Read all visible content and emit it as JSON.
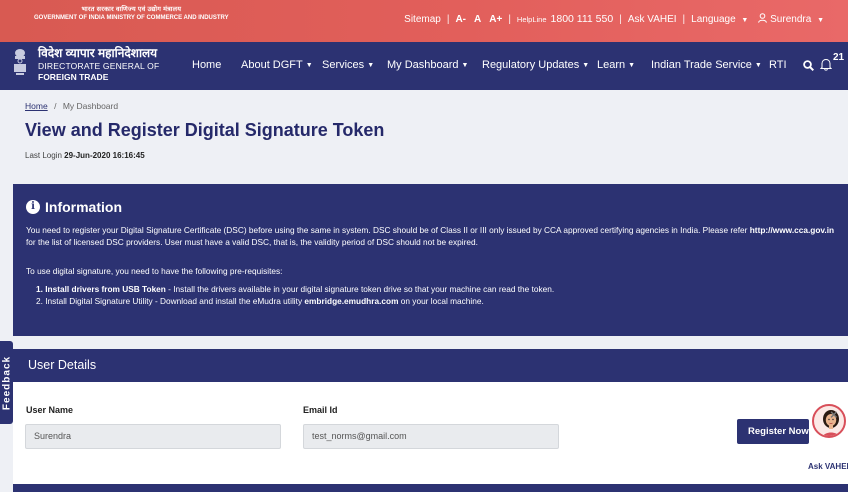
{
  "header": {
    "gov_hindi": "भारत सरकार  वाणिज्य एवं उद्योग मंत्रालय",
    "gov_english": "GOVERNMENT OF INDIA  MINISTRY OF COMMERCE AND INDUSTRY",
    "utility": {
      "sitemap": "Sitemap",
      "font_decrease": "A-",
      "font_normal": "A",
      "font_increase": "A+",
      "helpline_label": "HelpLine",
      "helpline_number": "1800 111 550",
      "ask_vahei": "Ask VAHEI",
      "language": "Language",
      "user": "Surendra"
    }
  },
  "brand": {
    "hindi": "विदेश व्यापार महानिदेशालय",
    "line2": "DIRECTORATE GENERAL OF",
    "line3": "FOREIGN TRADE"
  },
  "nav": {
    "home": "Home",
    "about": "About DGFT",
    "services": "Services",
    "dashboard": "My Dashboard",
    "regulatory": "Regulatory Updates",
    "learn": "Learn",
    "trade_service": "Indian Trade Service",
    "rti": "RTI",
    "notification_count": "21"
  },
  "breadcrumb": {
    "home": "Home",
    "separator": "/",
    "current": "My Dashboard"
  },
  "page": {
    "title": "View and Register Digital Signature Token",
    "last_login_label": "Last Login",
    "last_login_value": "29-Jun-2020 16:16:45"
  },
  "info": {
    "heading": "Information",
    "p1_a": "You need to register your Digital Signature Certificate (DSC) before using the same in system. DSC should be of Class II or III only issued by CCA approved certifying agencies in India. Please refer ",
    "p1_link": "http://www.cca.gov.in",
    "p1_b": " for the list of licensed DSC providers. User must have a valid DSC, that is, the validity period of DSC should not be expired.",
    "p2": "To use digital signature, you need to have the following pre-requisites:",
    "item1_bold": "1. Install drivers from USB Token",
    "item1_text": " - Install the drivers available in your digital signature token drive so that your machine can read the token.",
    "item2_text": "2. Install Digital Signature Utility - Download and install the eMudra utility ",
    "item2_bold": "embridge.emudhra.com",
    "item2_tail": " on your local machine."
  },
  "user_details": {
    "heading": "User Details",
    "username_label": "User Name",
    "username_value": "Surendra",
    "email_label": "Email Id",
    "email_value": "test_norms@gmail.com",
    "register_button": "Register Now"
  },
  "feedback": "Feedback",
  "vahei_widget": {
    "label": "Ask VAHEI",
    "close": "×"
  },
  "colors": {
    "top_bar": "#e25f5b",
    "navy": "#2c3272",
    "background": "#eef0f5"
  }
}
